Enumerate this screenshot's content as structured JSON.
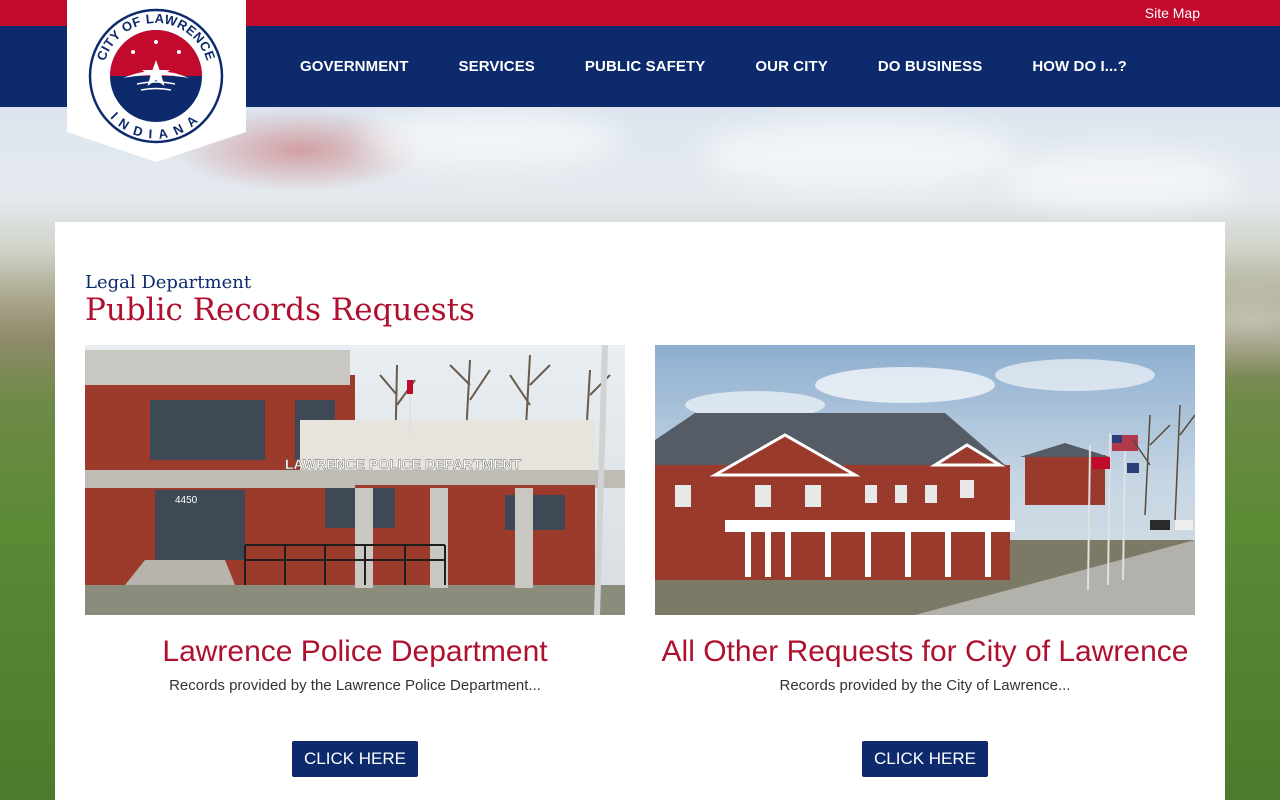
{
  "header": {
    "site_map_label": "Site Map",
    "logo": {
      "top_text": "CITY OF LAWRENCE",
      "bottom_text": "INDIANA"
    },
    "nav": [
      {
        "label": "GOVERNMENT"
      },
      {
        "label": "SERVICES"
      },
      {
        "label": "PUBLIC SAFETY"
      },
      {
        "label": "OUR CITY"
      },
      {
        "label": "DO BUSINESS"
      },
      {
        "label": "HOW DO I...?"
      }
    ]
  },
  "main": {
    "department": "Legal Department",
    "title": "Public Records Requests",
    "cards": [
      {
        "image_caption": "LAWRENCE POLICE DEPARTMENT",
        "image_sign": "4450",
        "title": "Lawrence Police Department",
        "description": "Records provided by the Lawrence Police Department...",
        "button_label": "CLICK HERE"
      },
      {
        "title": "All Other Requests for City of Lawrence",
        "description": "Records provided by the City of Lawrence...",
        "button_label": "CLICK HERE"
      }
    ]
  },
  "colors": {
    "brand_red": "#c10a2c",
    "brand_navy": "#0c2a6c",
    "title_red": "#b01030"
  }
}
